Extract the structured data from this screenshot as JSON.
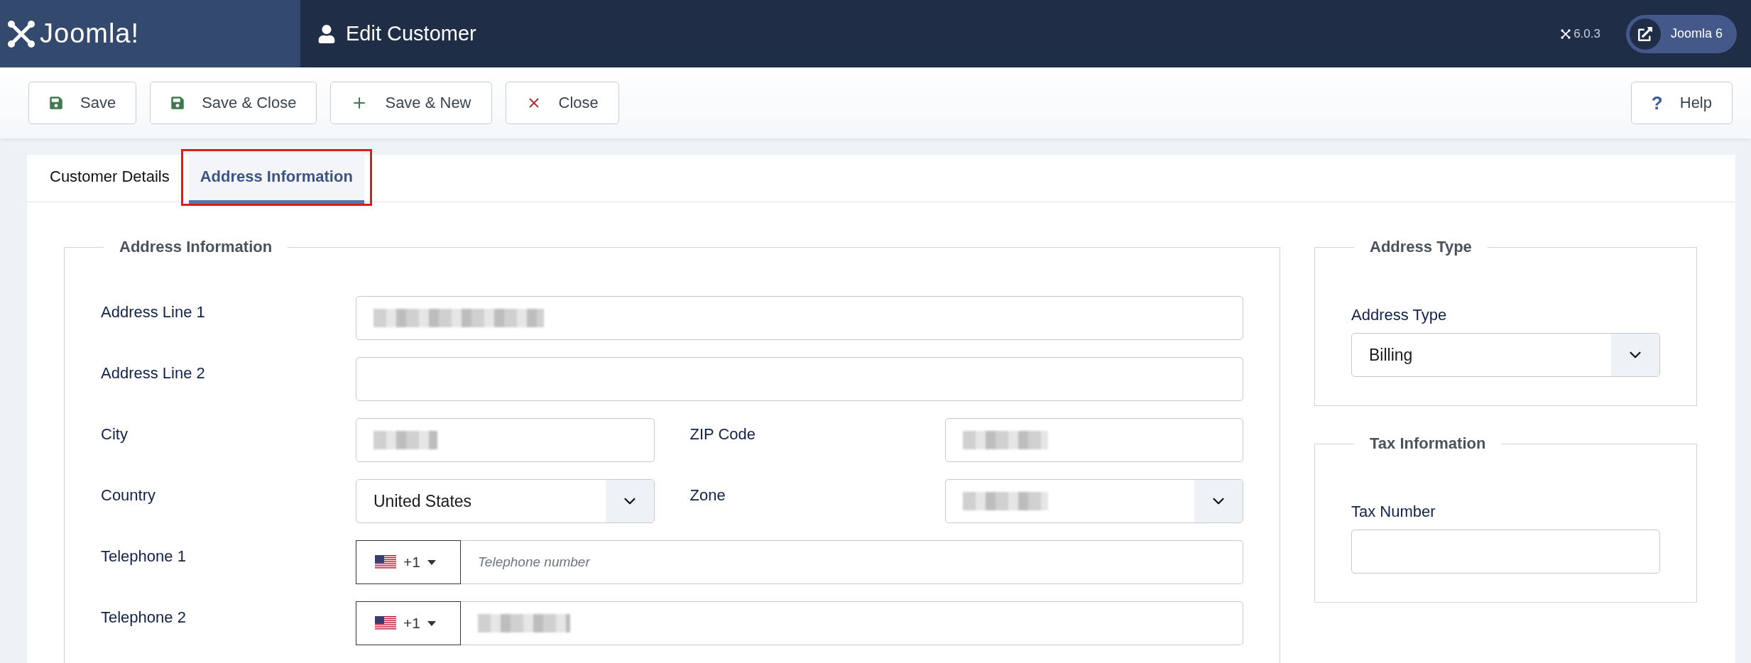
{
  "header": {
    "logo_text": "Joomla!",
    "title": "Edit Customer",
    "version": "6.0.3",
    "site_button": "Joomla 6"
  },
  "toolbar": {
    "buttons": [
      {
        "label": "Save",
        "kind": "save"
      },
      {
        "label": "Save & Close",
        "kind": "save"
      },
      {
        "label": "Save & New",
        "kind": "new"
      },
      {
        "label": "Close",
        "kind": "close"
      }
    ],
    "help": {
      "icon": "?",
      "label": "Help"
    }
  },
  "tabs": [
    {
      "label": "Customer Details",
      "selected": false,
      "highlighted": false
    },
    {
      "label": "Address Information",
      "selected": true,
      "highlighted": true
    }
  ],
  "address_section": {
    "legend": "Address Information",
    "rows": [
      {
        "fields": [
          {
            "label": "Address Line 1",
            "kind": "text",
            "redacted": true
          }
        ]
      },
      {
        "fields": [
          {
            "label": "Address Line 2",
            "kind": "text"
          }
        ]
      },
      {
        "fields": [
          {
            "label": "City",
            "kind": "text",
            "redacted": true
          },
          {
            "label": "ZIP Code",
            "kind": "text",
            "redacted": true
          }
        ]
      },
      {
        "fields": [
          {
            "label": "Country",
            "kind": "select",
            "value": "United States"
          },
          {
            "label": "Zone",
            "kind": "select",
            "redacted": true
          }
        ]
      },
      {
        "fields": [
          {
            "label": "Telephone 1",
            "kind": "phone",
            "dial_code": "+1",
            "placeholder": "Telephone number"
          }
        ]
      },
      {
        "fields": [
          {
            "label": "Telephone 2",
            "kind": "phone",
            "dial_code": "+1",
            "redacted": true
          }
        ]
      }
    ]
  },
  "side_sections": [
    {
      "legend": "Address Type",
      "field": {
        "label": "Address Type",
        "kind": "select",
        "value": "Billing"
      }
    },
    {
      "legend": "Tax Information",
      "field": {
        "label": "Tax Number",
        "kind": "text"
      }
    }
  ]
}
